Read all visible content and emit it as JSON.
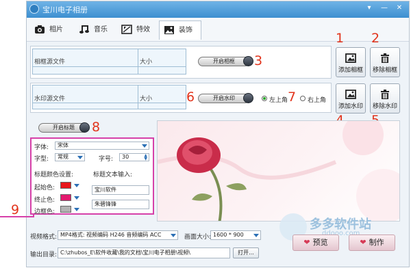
{
  "app": {
    "title": "宝川电子相册"
  },
  "window_controls": {
    "menu": "▾",
    "minimize": "—",
    "close": "✕"
  },
  "tabs": [
    {
      "label": "相片",
      "icon": "camera-icon"
    },
    {
      "label": "音乐",
      "icon": "music-icon"
    },
    {
      "label": "特效",
      "icon": "effects-icon"
    },
    {
      "label": "装饰",
      "icon": "image-icon"
    }
  ],
  "frame": {
    "col1": "相框源文件",
    "col2": "大小",
    "toggle_label": "开启相框",
    "add_label": "添加相框",
    "remove_label": "移除相框"
  },
  "watermark": {
    "col1": "水印源文件",
    "col2": "大小",
    "toggle_label": "开启水印",
    "pos_top_left": "左上角",
    "pos_top_right": "右上角",
    "add_label": "添加水印",
    "remove_label": "移除水印"
  },
  "title_settings": {
    "toggle_label": "开启标题",
    "font_label": "字体:",
    "font_value": "宋体",
    "style_label": "字型:",
    "style_value": "常规",
    "size_label": "字号:",
    "size_value": "30",
    "color_header": "标题颜色设置:",
    "start_label": "起始色:",
    "start_color": "#e8161b",
    "end_label": "终止色:",
    "end_color": "#e4196f",
    "border_label": "边框色:",
    "border_color": "#b3b3b3",
    "text_header": "标题文本输入:",
    "text1": "宝川软件",
    "text2": "朱碧锋锋"
  },
  "callouts": [
    "1",
    "2",
    "3",
    "4",
    "5",
    "6",
    "7",
    "8",
    "9"
  ],
  "output": {
    "format_label": "视频格式:",
    "format_value": "MP4格式: 视频编码 H246 音频编码 ACC",
    "size_label": "画面大小:",
    "size_value": "1600 * 900",
    "dir_label": "输出目录:",
    "dir_value": "C:\\zhubos_E\\软件收藏\\我的文档\\宝川电子相册\\视频\\",
    "open_label": "打开..."
  },
  "actions": {
    "preview_label": "预览",
    "make_label": "制作"
  },
  "watermark_brand": {
    "name": "多多软件站",
    "url": "ddooo.com"
  },
  "colors": {
    "accent": "#3d8fd0",
    "callout": "#e2341c"
  }
}
